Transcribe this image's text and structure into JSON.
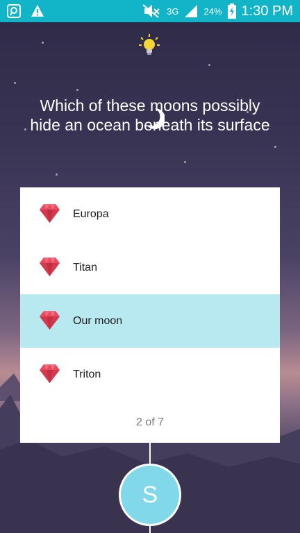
{
  "status_bar": {
    "signal_label": "3G",
    "battery": "24%",
    "time": "1:30 PM",
    "left_icons": [
      "app-notification-icon",
      "warning-icon"
    ],
    "right_icons": [
      "mute-icon",
      "signal-icon",
      "battery-charging-icon"
    ]
  },
  "quiz": {
    "question": "Which of these moons possibly hide an ocean beneath its surface",
    "options": [
      {
        "label": "Europa",
        "selected": false
      },
      {
        "label": "Titan",
        "selected": false
      },
      {
        "label": "Our moon",
        "selected": true
      },
      {
        "label": "Triton",
        "selected": false
      }
    ],
    "progress": "2 of 7"
  },
  "player": {
    "avatar_letter": "S"
  },
  "colors": {
    "status_bar": "#12b5c7",
    "selected_option": "#b8e9f1",
    "avatar": "#80d8e8",
    "gem": "#e84a5f"
  }
}
